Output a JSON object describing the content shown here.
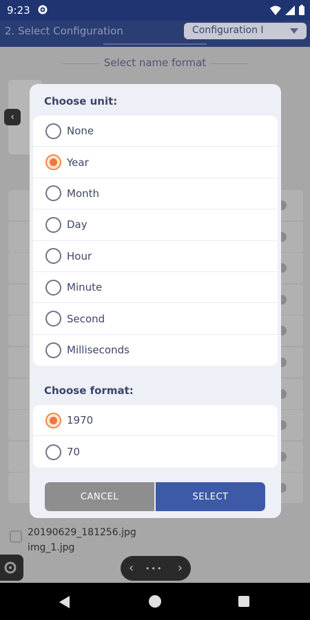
{
  "status_bar": {
    "time": "9:23"
  },
  "header": {
    "title": "2. Select Configuration",
    "config_select_value": "Configuration I"
  },
  "background": {
    "heading": "Select name format",
    "files": [
      "20190629_181256.jpg",
      "img_1.jpg"
    ]
  },
  "dialog": {
    "unit_title": "Choose unit:",
    "unit_options": [
      "None",
      "Year",
      "Month",
      "Day",
      "Hour",
      "Minute",
      "Second",
      "Milliseconds"
    ],
    "unit_selected": "Year",
    "format_title": "Choose format:",
    "format_options": [
      "1970",
      "70"
    ],
    "format_selected": "1970",
    "cancel_label": "CANCEL",
    "select_label": "SELECT"
  },
  "colors": {
    "accent_orange": "#f0763a",
    "primary_blue": "#3d5aa8",
    "header_navy": "#2b3e73"
  }
}
